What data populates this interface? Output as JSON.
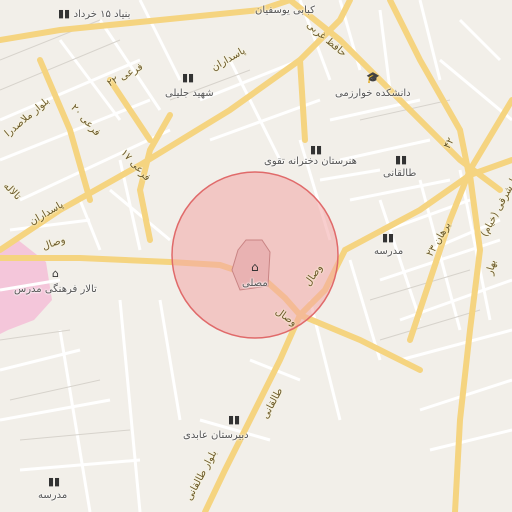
{
  "map": {
    "colors": {
      "background": "#f2efe9",
      "major_road": "#f5d480",
      "minor_road": "#ffffff",
      "block_outline": "#cfccc6",
      "highlight_fill": "#f2a6a6",
      "highlight_stroke": "#e06a6a",
      "pink_area": "#f4c6da",
      "label_text": "#555555"
    },
    "poi_labels": {
      "school_1": "بنیاد ۱۵ خرداد",
      "school_2": "کبابی یوسفیان",
      "school_3": "شهید جلیلی",
      "university": "دانشکده خوارزمی",
      "school_4": "هنرستان دخترانه تقوی",
      "school_5": "طالقانی",
      "school_6": "مدرسه",
      "musalla": "مصلی",
      "cultural_hall": "تالار فرهنگی مدرس",
      "school_7": "دبیرستان عابدی",
      "school_8": "مدرسه"
    },
    "street_labels": {
      "pasdaran_1": "پاسداران",
      "pasdaran_2": "پاسداران",
      "hafez_west": "حافظ غربی",
      "farei_22": "فرعی ۲۲",
      "farei_20": "فرعی ۲۰",
      "farei_17": "فرعی ۱۷",
      "molla_sadra": "بلوار ملاصدرا",
      "talaleh": "تالاله",
      "vesal_1": "وصال",
      "vesal_2": "وصال",
      "vesal_3": "وصال",
      "taleghani_blvd": "بلوار طالقانی",
      "taleghani": "طالقانی",
      "borhan_23": "برهان ۲۳",
      "hafez_sharghi": "حافظ شرقی (خیام)",
      "bahar": "بهار",
      "num_42": "۴۲"
    },
    "icons": {
      "school": "school-icon",
      "university": "university-icon",
      "musalla": "mosque-icon",
      "cultural": "museum-icon"
    }
  }
}
